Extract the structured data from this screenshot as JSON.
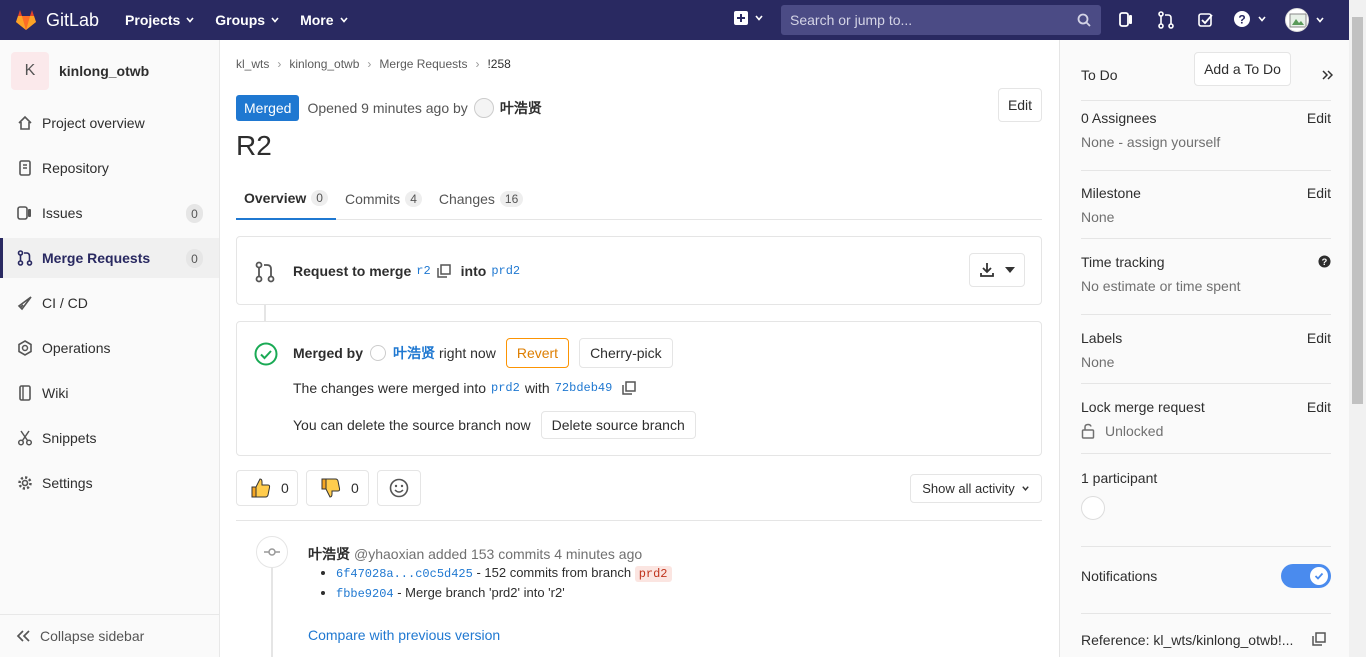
{
  "topnav": {
    "brand": "GitLab",
    "projects": "Projects",
    "groups": "Groups",
    "more": "More",
    "search_placeholder": "Search or jump to..."
  },
  "sidebar": {
    "project_initial": "K",
    "project_name": "kinlong_otwb",
    "items": [
      {
        "label": "Project overview",
        "icon": "home-icon"
      },
      {
        "label": "Repository",
        "icon": "document-icon"
      },
      {
        "label": "Issues",
        "icon": "issues-icon",
        "count": "0"
      },
      {
        "label": "Merge Requests",
        "icon": "merge-request-icon",
        "count": "0",
        "active": true
      },
      {
        "label": "CI / CD",
        "icon": "rocket-icon"
      },
      {
        "label": "Operations",
        "icon": "cloud-gear-icon"
      },
      {
        "label": "Wiki",
        "icon": "book-icon"
      },
      {
        "label": "Snippets",
        "icon": "scissors-icon"
      },
      {
        "label": "Settings",
        "icon": "gear-icon"
      }
    ],
    "collapse": "Collapse sidebar"
  },
  "breadcrumb": [
    "kl_wts",
    "kinlong_otwb",
    "Merge Requests",
    "!258"
  ],
  "mr": {
    "status": "Merged",
    "opened": "Opened 9 minutes ago by",
    "author": "叶浩贤",
    "edit": "Edit",
    "title": "R2",
    "tabs": [
      {
        "label": "Overview",
        "count": "0"
      },
      {
        "label": "Commits",
        "count": "4"
      },
      {
        "label": "Changes",
        "count": "16"
      }
    ],
    "request_to_merge": "Request to merge",
    "source_branch": "r2",
    "into": "into",
    "target_branch": "prd2",
    "merged_by": "Merged by",
    "merged_by_user": "叶浩贤",
    "merged_when": "right now",
    "revert": "Revert",
    "cherry_pick": "Cherry-pick",
    "merged_into_text": "The changes were merged into",
    "merged_into_branch": "prd2",
    "with": "with",
    "commit_sha": "72bdeb49",
    "delete_text": "You can delete the source branch now",
    "delete_button": "Delete source branch",
    "thumbs_up": "0",
    "thumbs_down": "0",
    "show_activity": "Show all activity",
    "activity_author": "叶浩贤",
    "activity_handle": "@yhaoxian added 153 commits 4 minutes ago",
    "commit1_range": "6f47028a...c0c5d425",
    "commit1_text": "- 152 commits from branch",
    "commit1_branch": "prd2",
    "commit2_sha": "fbbe9204",
    "commit2_text": "- Merge branch 'prd2' into 'r2'",
    "compare": "Compare with previous version"
  },
  "right_sidebar": {
    "todo": "To Do",
    "add_todo": "Add a To Do",
    "assignees": "0 Assignees",
    "assignees_edit": "Edit",
    "assignees_none": "None -",
    "assign_yourself": "assign yourself",
    "milestone": "Milestone",
    "milestone_edit": "Edit",
    "milestone_value": "None",
    "time_tracking": "Time tracking",
    "time_value": "No estimate or time spent",
    "labels": "Labels",
    "labels_edit": "Edit",
    "labels_value": "None",
    "lock": "Lock merge request",
    "lock_edit": "Edit",
    "lock_value": "Unlocked",
    "participants": "1 participant",
    "notifications": "Notifications",
    "notifications_on": true,
    "reference": "Reference: kl_wts/kinlong_otwb!..."
  },
  "colors": {
    "nav": "#292961",
    "link": "#1f78d1",
    "success": "#1aaa55",
    "revert": "#fc9403"
  }
}
